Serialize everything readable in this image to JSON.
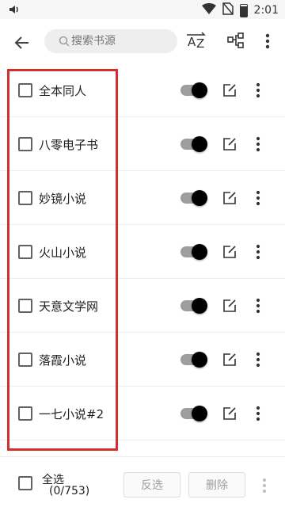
{
  "status": {
    "time": "2:01"
  },
  "toolbar": {
    "search_placeholder": "搜索书源",
    "sort_icon": "sort-az-icon",
    "group_icon": "group-icon",
    "more_icon": "more-vertical-icon"
  },
  "sources": [
    {
      "name": "全本同人",
      "checked": false,
      "enabled": true
    },
    {
      "name": "八零电子书",
      "checked": false,
      "enabled": true
    },
    {
      "name": "妙镜小说",
      "checked": false,
      "enabled": true
    },
    {
      "name": "火山小说",
      "checked": false,
      "enabled": true
    },
    {
      "name": "天意文学网",
      "checked": false,
      "enabled": true
    },
    {
      "name": "落霞小说",
      "checked": false,
      "enabled": true
    },
    {
      "name": "一七小说#2",
      "checked": false,
      "enabled": true
    }
  ],
  "bottom": {
    "select_all_label": "全选",
    "select_count": "(0/753)",
    "invert_label": "反选",
    "delete_label": "删除"
  },
  "colors": {
    "highlight": "#d32f2f",
    "toggle_knob": "#000000",
    "toggle_track": "#9e9e9e"
  }
}
